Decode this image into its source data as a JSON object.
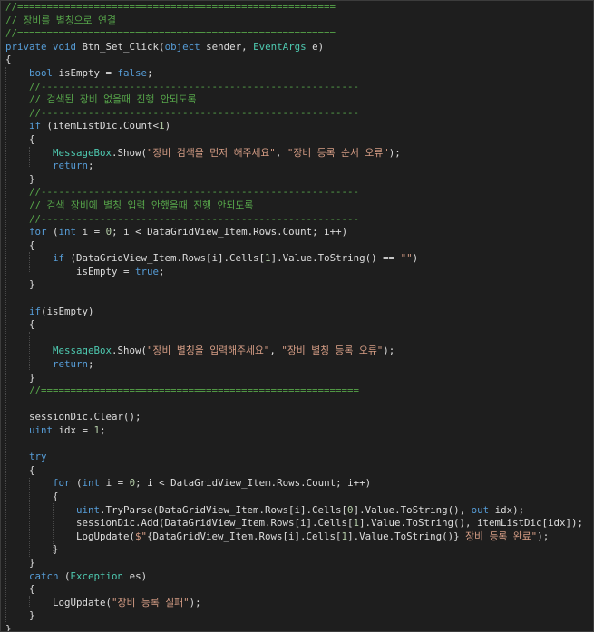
{
  "theme": {
    "background": "#1e1e1e",
    "colors": {
      "kw": "#569cd6",
      "cm": "#57a64a",
      "tp": "#4ec9b0",
      "str": "#d69d85",
      "num": "#b5cea8",
      "id": "#dcdcdc"
    }
  },
  "code_lines": [
    [
      [
        "cm",
        "//======================================================"
      ]
    ],
    [
      [
        "cm",
        "// 장비를 별칭으로 연결"
      ]
    ],
    [
      [
        "cm",
        "//======================================================"
      ]
    ],
    [
      [
        "kw",
        "private"
      ],
      [
        "id",
        " "
      ],
      [
        "kw",
        "void"
      ],
      [
        "id",
        " Btn_Set_Click("
      ],
      [
        "kw",
        "object"
      ],
      [
        "id",
        " sender, "
      ],
      [
        "tp",
        "EventArgs"
      ],
      [
        "id",
        " e)"
      ]
    ],
    [
      [
        "id",
        "{"
      ]
    ],
    [
      [
        "id",
        "    "
      ],
      [
        "kw",
        "bool"
      ],
      [
        "id",
        " isEmpty = "
      ],
      [
        "kw",
        "false"
      ],
      [
        "id",
        ";"
      ]
    ],
    [
      [
        "id",
        "    "
      ],
      [
        "cm",
        "//------------------------------------------------------"
      ]
    ],
    [
      [
        "id",
        "    "
      ],
      [
        "cm",
        "// 검색된 장비 없을때 진행 안되도록"
      ]
    ],
    [
      [
        "id",
        "    "
      ],
      [
        "cm",
        "//------------------------------------------------------"
      ]
    ],
    [
      [
        "id",
        "    "
      ],
      [
        "kw",
        "if"
      ],
      [
        "id",
        " (itemListDic.Count<"
      ],
      [
        "num",
        "1"
      ],
      [
        "id",
        ")"
      ]
    ],
    [
      [
        "id",
        "    {"
      ]
    ],
    [
      [
        "id",
        "        "
      ],
      [
        "tp",
        "MessageBox"
      ],
      [
        "id",
        ".Show("
      ],
      [
        "str",
        "\"장비 검색을 먼저 해주세요\""
      ],
      [
        "id",
        ", "
      ],
      [
        "str",
        "\"장비 등록 순서 오류\""
      ],
      [
        "id",
        ");"
      ]
    ],
    [
      [
        "id",
        "        "
      ],
      [
        "kw",
        "return"
      ],
      [
        "id",
        ";"
      ]
    ],
    [
      [
        "id",
        "    }"
      ]
    ],
    [
      [
        "id",
        "    "
      ],
      [
        "cm",
        "//------------------------------------------------------"
      ]
    ],
    [
      [
        "id",
        "    "
      ],
      [
        "cm",
        "// 검색 장비에 별칭 입력 안했을때 진행 안되도록"
      ]
    ],
    [
      [
        "id",
        "    "
      ],
      [
        "cm",
        "//------------------------------------------------------"
      ]
    ],
    [
      [
        "id",
        "    "
      ],
      [
        "kw",
        "for"
      ],
      [
        "id",
        " ("
      ],
      [
        "kw",
        "int"
      ],
      [
        "id",
        " i = "
      ],
      [
        "num",
        "0"
      ],
      [
        "id",
        "; i < DataGridView_Item.Rows.Count; i++)"
      ]
    ],
    [
      [
        "id",
        "    {"
      ]
    ],
    [
      [
        "id",
        "        "
      ],
      [
        "kw",
        "if"
      ],
      [
        "id",
        " (DataGridView_Item.Rows[i].Cells["
      ],
      [
        "num",
        "1"
      ],
      [
        "id",
        "].Value.ToString() == "
      ],
      [
        "str",
        "\"\""
      ],
      [
        "id",
        ")"
      ]
    ],
    [
      [
        "id",
        "            isEmpty = "
      ],
      [
        "kw",
        "true"
      ],
      [
        "id",
        ";"
      ]
    ],
    [
      [
        "id",
        "    }"
      ]
    ],
    [
      [
        "id",
        ""
      ]
    ],
    [
      [
        "id",
        "    "
      ],
      [
        "kw",
        "if"
      ],
      [
        "id",
        "(isEmpty)"
      ]
    ],
    [
      [
        "id",
        "    {"
      ]
    ],
    [
      [
        "id",
        ""
      ]
    ],
    [
      [
        "id",
        "        "
      ],
      [
        "tp",
        "MessageBox"
      ],
      [
        "id",
        ".Show("
      ],
      [
        "str",
        "\"장비 별칭을 입력해주세요\""
      ],
      [
        "id",
        ", "
      ],
      [
        "str",
        "\"장비 별칭 등록 오류\""
      ],
      [
        "id",
        ");"
      ]
    ],
    [
      [
        "id",
        "        "
      ],
      [
        "kw",
        "return"
      ],
      [
        "id",
        ";"
      ]
    ],
    [
      [
        "id",
        "    }"
      ]
    ],
    [
      [
        "id",
        "    "
      ],
      [
        "cm",
        "//======================================================"
      ]
    ],
    [
      [
        "id",
        ""
      ]
    ],
    [
      [
        "id",
        "    sessionDic.Clear();"
      ]
    ],
    [
      [
        "id",
        "    "
      ],
      [
        "kw",
        "uint"
      ],
      [
        "id",
        " idx = "
      ],
      [
        "num",
        "1"
      ],
      [
        "id",
        ";"
      ]
    ],
    [
      [
        "id",
        ""
      ]
    ],
    [
      [
        "id",
        "    "
      ],
      [
        "kw",
        "try"
      ]
    ],
    [
      [
        "id",
        "    {"
      ]
    ],
    [
      [
        "id",
        "        "
      ],
      [
        "kw",
        "for"
      ],
      [
        "id",
        " ("
      ],
      [
        "kw",
        "int"
      ],
      [
        "id",
        " i = "
      ],
      [
        "num",
        "0"
      ],
      [
        "id",
        "; i < DataGridView_Item.Rows.Count; i++)"
      ]
    ],
    [
      [
        "id",
        "        {"
      ]
    ],
    [
      [
        "id",
        "            "
      ],
      [
        "kw",
        "uint"
      ],
      [
        "id",
        ".TryParse(DataGridView_Item.Rows[i].Cells["
      ],
      [
        "num",
        "0"
      ],
      [
        "id",
        "].Value.ToString(), "
      ],
      [
        "kw",
        "out"
      ],
      [
        "id",
        " idx);"
      ]
    ],
    [
      [
        "id",
        "            sessionDic.Add(DataGridView_Item.Rows[i].Cells["
      ],
      [
        "num",
        "1"
      ],
      [
        "id",
        "].Value.ToString(), itemListDic[idx]);"
      ]
    ],
    [
      [
        "id",
        "            LogUpdate("
      ],
      [
        "str",
        "$\""
      ],
      [
        "id",
        "{DataGridView_Item.Rows[i].Cells["
      ],
      [
        "num",
        "1"
      ],
      [
        "id",
        "].Value.ToString()}"
      ],
      [
        "str",
        " 장비 등록 완료\""
      ],
      [
        "id",
        ");"
      ]
    ],
    [
      [
        "id",
        "        }"
      ]
    ],
    [
      [
        "id",
        "    }"
      ]
    ],
    [
      [
        "id",
        "    "
      ],
      [
        "kw",
        "catch"
      ],
      [
        "id",
        " ("
      ],
      [
        "tp",
        "Exception"
      ],
      [
        "id",
        " es)"
      ]
    ],
    [
      [
        "id",
        "    {"
      ]
    ],
    [
      [
        "id",
        "        LogUpdate("
      ],
      [
        "str",
        "\"장비 등록 실패\""
      ],
      [
        "id",
        ");"
      ]
    ],
    [
      [
        "id",
        "    }"
      ]
    ],
    [
      [
        "id",
        "}"
      ]
    ]
  ]
}
